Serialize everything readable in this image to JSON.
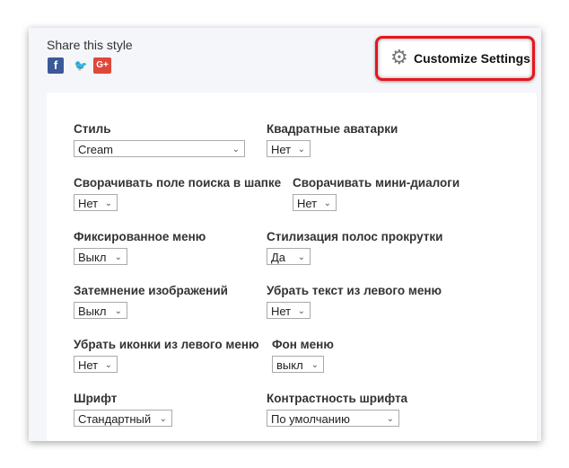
{
  "header": {
    "share_label": "Share this style",
    "social": [
      {
        "name": "facebook",
        "glyph": "f"
      },
      {
        "name": "twitter",
        "glyph": "🐦"
      },
      {
        "name": "google-plus",
        "glyph": "G+"
      }
    ],
    "customize_label": "Customize Settings"
  },
  "settings": [
    {
      "label": "Стиль",
      "value": "Cream"
    },
    {
      "label": "Квадратные аватарки",
      "value": "Нет"
    },
    {
      "label": "Сворачивать поле поиска в шапке",
      "value": "Нет"
    },
    {
      "label": "Сворачивать мини-диалоги",
      "value": "Нет"
    },
    {
      "label": "Фиксированное меню",
      "value": "Выкл"
    },
    {
      "label": "Стилизация полос прокрутки",
      "value": "Да"
    },
    {
      "label": "Затемнение изображений",
      "value": "Выкл"
    },
    {
      "label": "Убрать текст из левого меню",
      "value": "Нет"
    },
    {
      "label": "Убрать иконки из левого меню",
      "value": "Нет"
    },
    {
      "label": "Фон меню",
      "value": "выкл"
    },
    {
      "label": "Шрифт",
      "value": "Стандартный"
    },
    {
      "label": "Контрастность шрифта",
      "value": "По умолчанию"
    }
  ],
  "colors": {
    "highlight": "#e8141c",
    "facebook": "#3b5998",
    "google": "#e0473a"
  }
}
